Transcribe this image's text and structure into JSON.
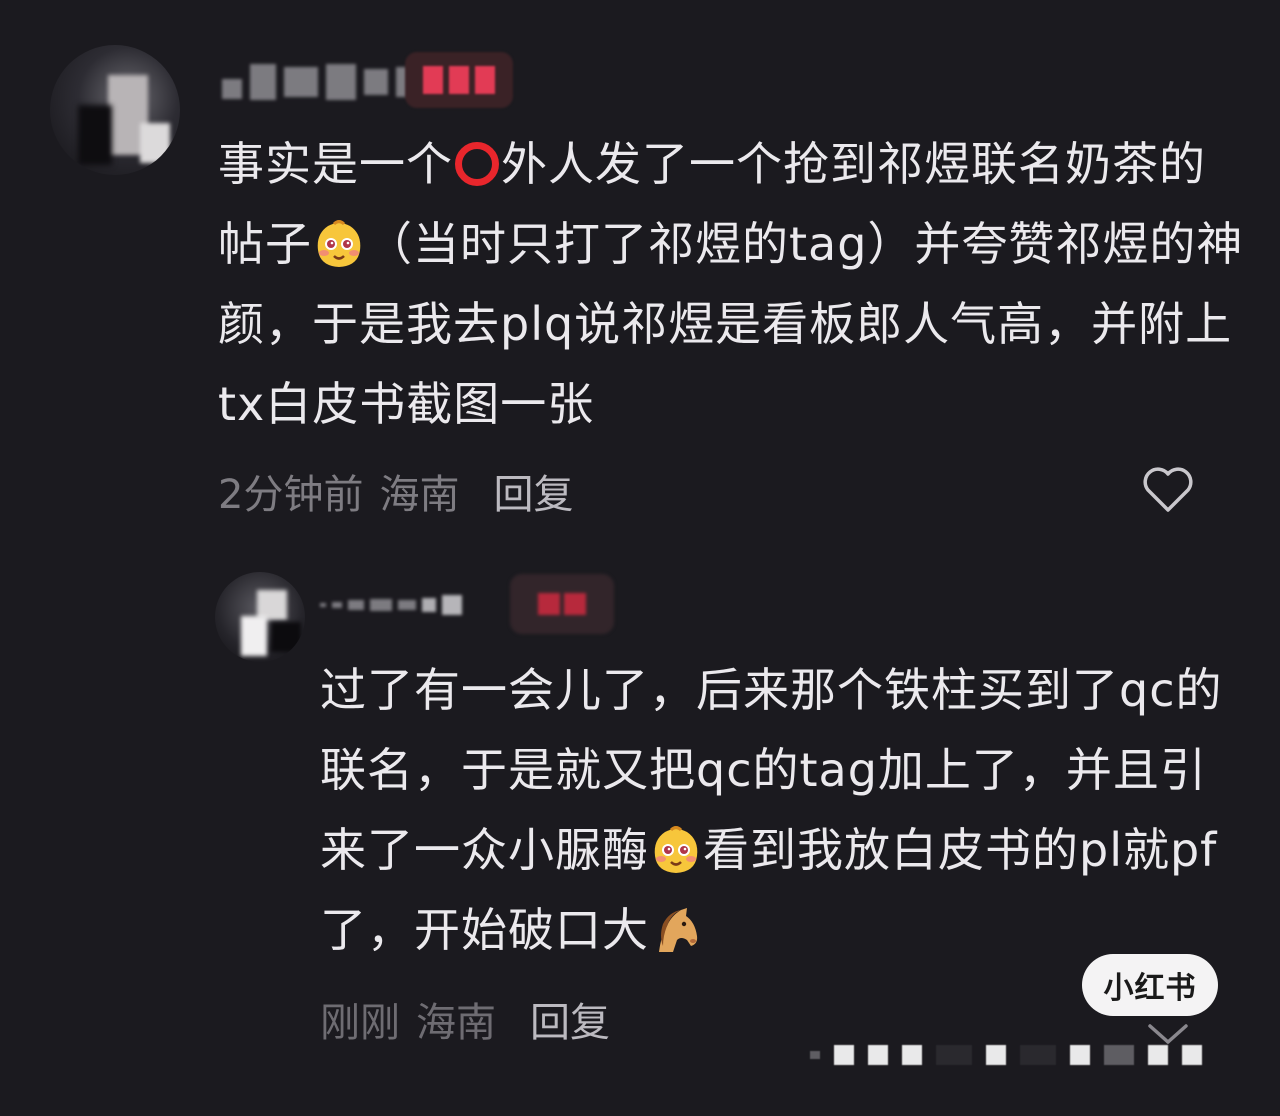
{
  "main_comment": {
    "avatar": "user-avatar",
    "username": "",
    "badge": "",
    "text_segments": [
      {
        "type": "text",
        "value": "事实是一个"
      },
      {
        "type": "icon",
        "value": "red-circle-emoji"
      },
      {
        "type": "text",
        "value": "外人发了一个抢到祁煜联名奶茶的帖子"
      },
      {
        "type": "icon",
        "value": "blushing-face-emoji"
      },
      {
        "type": "text",
        "value": "（当时只打了祁煜的tag）并夸赞祁煜的神颜，于是我去plq说祁煜是看板郎人气高，并附上tx白皮书截图一张"
      }
    ],
    "time": "2分钟前",
    "location": "海南",
    "reply_label": "回复",
    "like_icon": "heart-outline-icon"
  },
  "reply_comment": {
    "avatar": "user-avatar",
    "username": "",
    "badge": "",
    "text_segments": [
      {
        "type": "text",
        "value": "过了有一会儿了，后来那个铁柱买到了qc的联名，于是就又把qc的tag加上了，并且引来了一众小脲酶"
      },
      {
        "type": "icon",
        "value": "blushing-face-emoji"
      },
      {
        "type": "text",
        "value": "看到我放白皮书的pl就pf了，开始破口大"
      },
      {
        "type": "icon",
        "value": "horse-emoji"
      }
    ],
    "time": "刚刚",
    "location": "海南",
    "reply_label": "回复",
    "like_icon": "heart-outline-icon"
  },
  "watermark": {
    "label": "小红书"
  },
  "colors": {
    "background": "#1b1a1f",
    "text": "#ebe9ed",
    "meta": "#7e7c82",
    "reply": "#bcbac0",
    "circle_emoji": "#e8262c"
  }
}
